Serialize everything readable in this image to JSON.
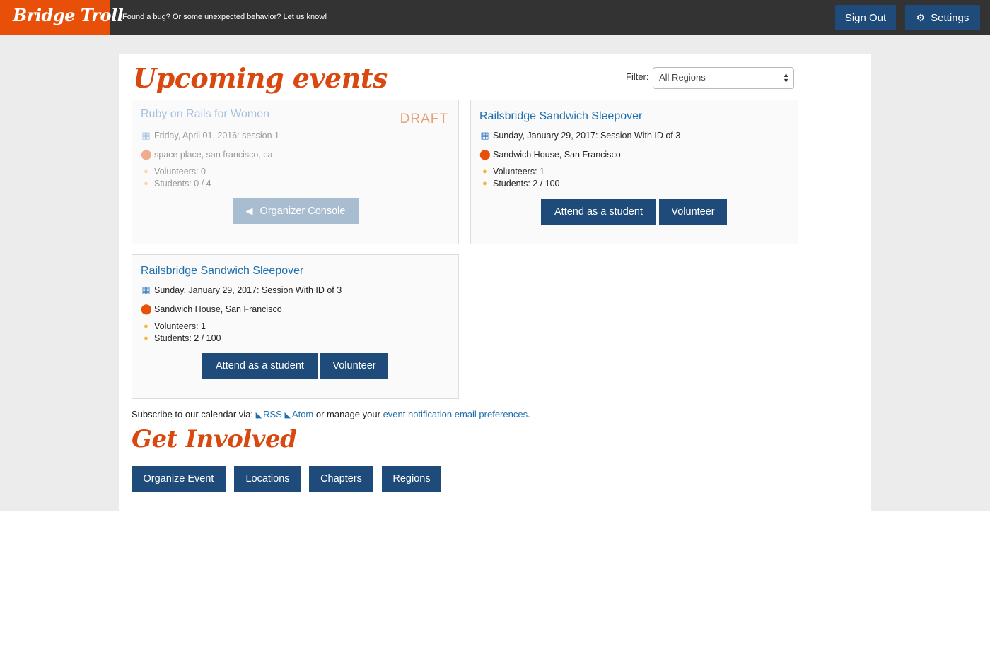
{
  "brand": {
    "name": "Bridge Troll"
  },
  "topbar": {
    "bug_text": "Found a bug? Or some unexpected behavior?",
    "bug_link": "Let us know",
    "bug_suffix": "!",
    "signout_label": "Sign Out",
    "settings_label": "Settings"
  },
  "page": {
    "title": "Upcoming events",
    "get_involved_title": "Get Involved"
  },
  "filter": {
    "label": "Filter:",
    "selected": "All Regions"
  },
  "events": [
    {
      "title": "Ruby on Rails for Women",
      "status": "DRAFT",
      "date": "Friday, April 01, 2016: session 1",
      "location": "space place, san francisco, ca",
      "volunteers": "Volunteers: 0",
      "students": "Students: 0 / 4",
      "button": "Organizer Console"
    },
    {
      "title": "Railsbridge Sandwich Sleepover",
      "date": "Sunday, January 29, 2017: Session With ID of 3",
      "location": "Sandwich House, San Francisco",
      "volunteers": "Volunteers: 1",
      "students": "Students: 2 / 100",
      "attend_label": "Attend as a student",
      "volunteer_label": "Volunteer"
    },
    {
      "title": "Railsbridge Sandwich Sleepover",
      "date": "Sunday, January 29, 2017: Session With ID of 3",
      "location": "Sandwich House, San Francisco",
      "volunteers": "Volunteers: 1",
      "students": "Students: 2 / 100",
      "attend_label": "Attend as a student",
      "volunteer_label": "Volunteer"
    }
  ],
  "subscribe": {
    "prefix": "Subscribe to our calendar via:",
    "rss": "RSS",
    "atom": "Atom",
    "middle": "or manage your",
    "prefs_link": "event notification email preferences",
    "suffix": "."
  },
  "get_involved": {
    "buttons": [
      "Organize Event",
      "Locations",
      "Chapters",
      "Regions"
    ]
  }
}
